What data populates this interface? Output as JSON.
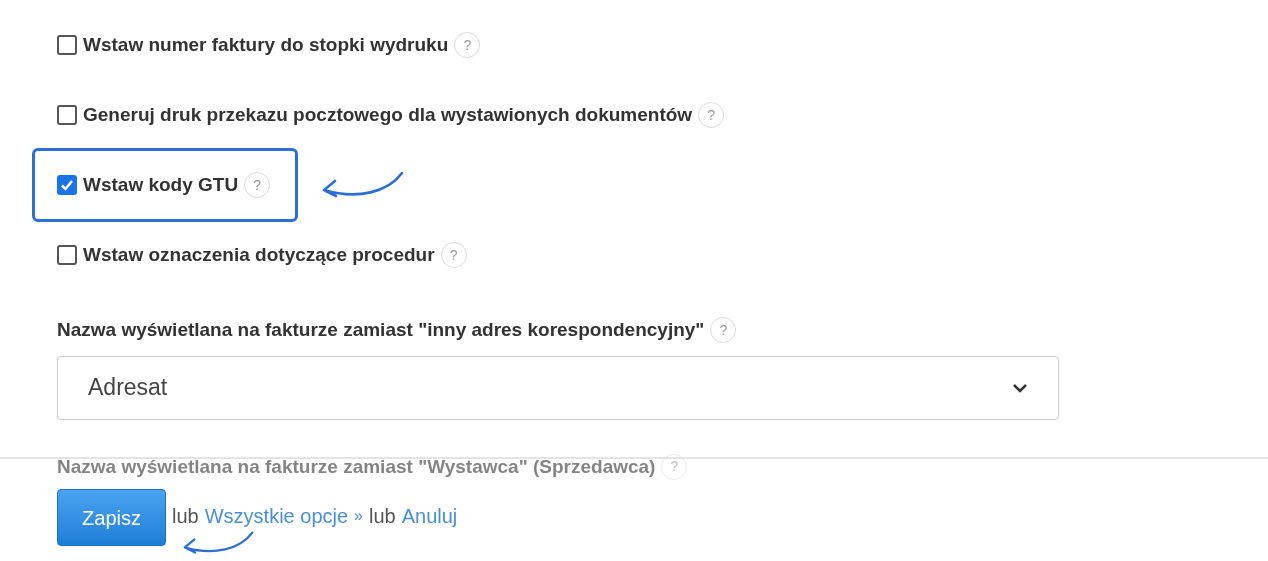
{
  "options": [
    {
      "label": "Wstaw numer faktury do stopki wydruku",
      "help": "?",
      "checked": false,
      "highlighted": false
    },
    {
      "label": "Generuj druk przekazu pocztowego dla wystawionych dokumentów",
      "help": "?",
      "checked": false,
      "highlighted": false
    },
    {
      "label": "Wstaw kody GTU",
      "help": "?",
      "checked": true,
      "highlighted": true
    },
    {
      "label": "Wstaw oznaczenia dotyczące procedur",
      "help": "?",
      "checked": false,
      "highlighted": false
    }
  ],
  "selects": [
    {
      "label": "Nazwa wyświetlana na fakturze zamiast \"inny adres korespondencyjny\"",
      "help": "?",
      "value": "Adresat"
    },
    {
      "label": "Nazwa wyświetlana na fakturze zamiast \"Wystawca\" (Sprzedawca)",
      "help": "?"
    }
  ],
  "footer": {
    "save_button": "Zapisz",
    "save_highlighted": true,
    "parts": [
      {
        "kind": "text",
        "text": "lub"
      },
      {
        "kind": "link",
        "text": "Wszystkie opcje"
      },
      {
        "kind": "mark",
        "text": "»"
      },
      {
        "kind": "text",
        "text": "lub"
      },
      {
        "kind": "link",
        "text": "Anuluj"
      }
    ]
  }
}
